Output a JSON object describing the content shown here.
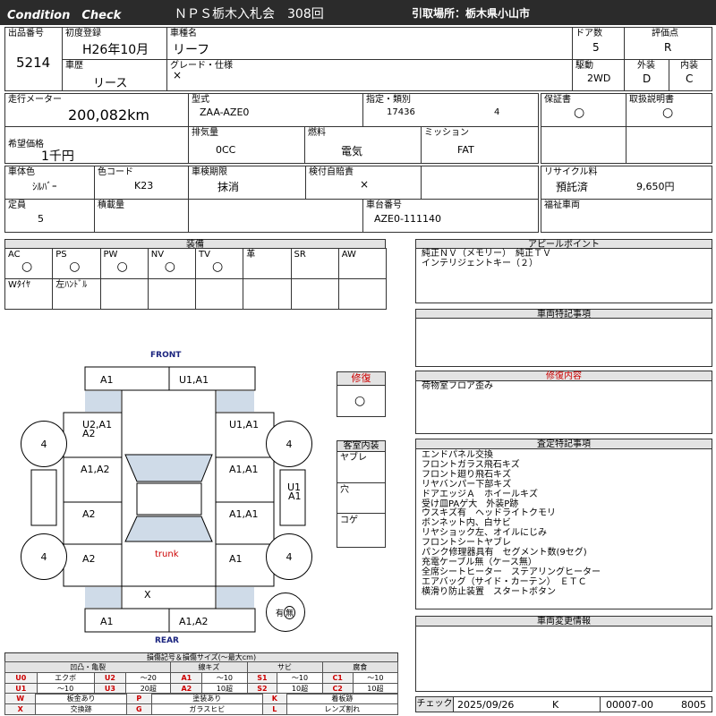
{
  "header": {
    "title_left": "Condition　Check",
    "auction": "ＮＰＳ栃木入札会　308回",
    "pickup": "引取場所：栃木県小山市"
  },
  "f": {
    "lot_no_label": "出品番号",
    "lot_no": "5214",
    "first_reg_label": "初度登録",
    "first_reg": "H26年10月",
    "model_name_label": "車種名",
    "model_name": "リーフ",
    "doors_label": "ドア数",
    "doors": "5",
    "score_label": "評価点",
    "score": "R",
    "history_label": "車歴",
    "history": "リース",
    "grade_label": "グレード・仕様",
    "grade": "×",
    "drive_label": "駆動",
    "drive": "2WD",
    "ext_label": "外装",
    "ext": "D",
    "int_label": "内装",
    "int": "C",
    "mileage_label": "走行メーター",
    "mileage": "200,082km",
    "type_label": "型式",
    "type": "ZAA-AZE0",
    "cert_label": "指定・類別",
    "cert1": "17436",
    "cert2": "4",
    "warranty_label": "保証書",
    "warranty": "○",
    "manual_label": "取扱説明書",
    "manual": "○",
    "price_label": "希望価格",
    "price": "1千円",
    "disp_label": "排気量",
    "disp": "0CC",
    "fuel_label": "燃料",
    "fuel": "電気",
    "mission_label": "ミッション",
    "mission": "FAT",
    "color_label": "車体色",
    "color": "ｼﾙﾊﾞｰ",
    "color_code_label": "色コード",
    "color_code": "K23",
    "inspection_label": "車検期限",
    "inspection": "抹消",
    "insurance_label": "検付自賠責",
    "insurance": "×",
    "recycle_label": "リサイクル料",
    "recycle_status": "預託済",
    "recycle_amount": "9,650円",
    "capacity_label": "定員",
    "capacity": "5",
    "load_label": "積載量",
    "chassis_label": "車台番号",
    "chassis": "AZE0-111140",
    "welfare_label": "福祉車両"
  },
  "equip": {
    "title": "装備",
    "h": [
      "AC",
      "PS",
      "PW",
      "NV",
      "TV",
      "革",
      "SR",
      "AW"
    ],
    "v": [
      "○",
      "○",
      "○",
      "○",
      "○",
      "",
      "",
      ""
    ],
    "r2": [
      "Wﾀｲﾔ",
      "左ﾊﾝﾄﾞﾙ",
      "",
      "",
      "",
      "",
      "",
      ""
    ]
  },
  "appeal": {
    "title": "アピールポイント",
    "l1": "純正ＮＶ（メモリー）　純正ＴＶ",
    "l2": "インテリジェントキー（２）"
  },
  "special": {
    "title": "車両特記事項"
  },
  "repair": {
    "title": "修復",
    "mark": "○"
  },
  "repair_detail": {
    "title": "修復内容",
    "text": "荷物室フロア歪み"
  },
  "interior": {
    "title": "客室内装",
    "a": "ヤブレ",
    "b": "穴",
    "c": "コゲ"
  },
  "inspection_notes": {
    "title": "査定特記事項",
    "lines": [
      "エンドパネル交換",
      "フロントガラス飛石キズ",
      "フロント廻り飛石キズ",
      "リヤバンパー下部キズ",
      "ドアエッジＡ　ホイールキズ",
      "受け皿PAゲ大　外装P跡",
      "ウスキズ有　ヘッドライトクモリ",
      "ボンネット内、白サビ",
      "リヤショック左、オイルにじみ",
      "フロントシートヤブレ",
      "パンク修理器具有　セグメント数(9セグ)",
      "充電ケーブル無（ケース無）",
      "全席シートヒーター　ステアリングヒーター",
      "エアバッグ（サイド・カーテン）　ＥＴＣ",
      "横滑り防止装置　スタートボタン"
    ]
  },
  "change": {
    "title": "車両変更情報"
  },
  "check": {
    "label": "チェック",
    "date": "2025/09/26",
    "k": "K",
    "code": "00007-00",
    "num": "8005"
  },
  "diagram": {
    "front": "FRONT",
    "rear": "REAR",
    "trunk": "trunk",
    "tire": "4",
    "spare": "有",
    "spare2": "無",
    "m_top_l": "A1",
    "m_top_r": "U1,A1",
    "m_fl_a": "U2,A1",
    "m_fl_b": "A2",
    "m_fr": "U1,A1",
    "m_dl": "A1,A2",
    "m_dr": "A1,A1",
    "m_rl": "A2",
    "m_rr": "A1,A1",
    "m_ql": "A2",
    "m_qr": "A1",
    "m_rear_x": "X",
    "m_bot_l": "A1",
    "m_bot_r": "A1,A2",
    "m_side_a": "U1",
    "m_side_b": "A1"
  },
  "legend": {
    "title": "損傷記号＆損傷サイズ(〜最大cm)",
    "g1": "凹凸・亀裂",
    "g2": "線キズ",
    "g3": "サビ",
    "g4": "腐食",
    "r1": [
      "U0",
      "エクボ",
      "U2",
      "〜20",
      "A1",
      "〜10",
      "S1",
      "〜10",
      "C1",
      "〜10"
    ],
    "r2": [
      "U1",
      "〜10",
      "U3",
      "20超",
      "A2",
      "10超",
      "S2",
      "10超",
      "C2",
      "10超"
    ],
    "r3": [
      "W",
      "板金あり",
      "P",
      "塗装あり",
      "K",
      "着板跡"
    ],
    "r4": [
      "X",
      "交換跡",
      "G",
      "ガラスヒビ",
      "L",
      "レンズ割れ"
    ]
  }
}
